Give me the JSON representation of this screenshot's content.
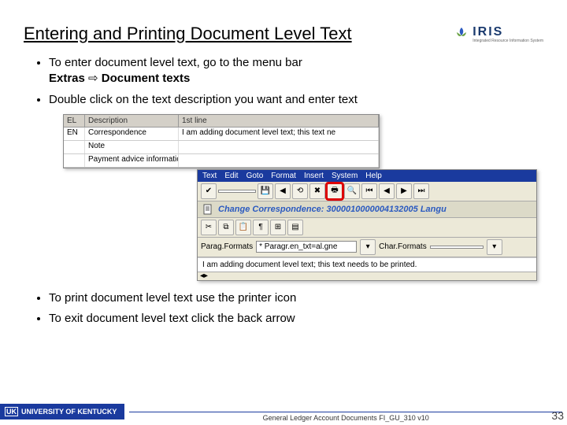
{
  "title": "Entering and Printing Document Level Text",
  "logo": {
    "name": "IRIS",
    "subtitle": "Integrated Resource Information System"
  },
  "bullets_top": [
    {
      "prefix": "To enter document level text, go to the menu bar",
      "path_a": "Extras",
      "path_b": "Document texts"
    },
    {
      "text": "Double click on the text description you want and enter text"
    }
  ],
  "bullets_bottom": [
    {
      "text": "To print document level text use the printer icon"
    },
    {
      "text": "To exit document level text click the back arrow"
    }
  ],
  "grid": {
    "headers": {
      "a": "EL",
      "b": "Description",
      "c": "1st line"
    },
    "rows": [
      {
        "a": "EN",
        "b": "Correspondence",
        "c": "I am adding document level text; this text ne"
      },
      {
        "a": "",
        "b": "Note",
        "c": ""
      },
      {
        "a": "",
        "b": "Payment advice information",
        "c": ""
      }
    ]
  },
  "win2": {
    "menus": [
      "Text",
      "Edit",
      "Goto",
      "Format",
      "Insert",
      "System",
      "Help"
    ],
    "doc_title": "Change Correspondence: 3000010000004132005 Langu",
    "format_label": "Parag.Formats",
    "format_value": "* Paragr.en_txt=al.gne",
    "char_label": "Char.Formats",
    "body": "I am adding document level text; this text needs to be printed."
  },
  "footer": {
    "org_init": "UK",
    "org": "UNIVERSITY OF KENTUCKY",
    "doc": "General Ledger Account Documents FI_GU_310 v10",
    "page": "33"
  }
}
